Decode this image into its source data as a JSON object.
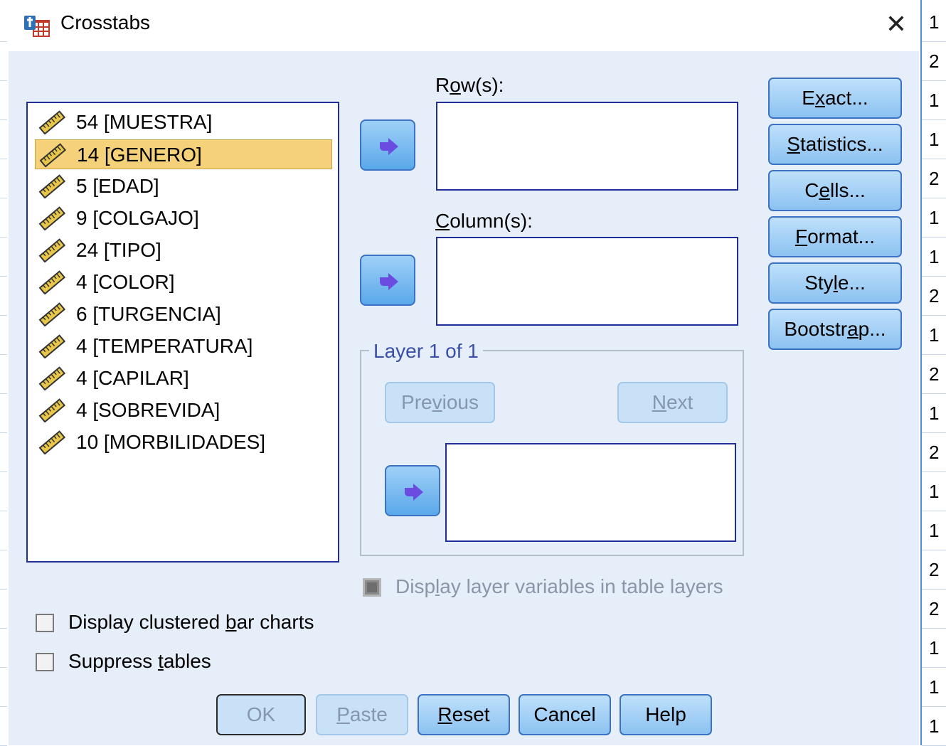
{
  "dialog": {
    "title": "Crosstabs",
    "close_glyph": "✕"
  },
  "variables": [
    {
      "label": "54 [MUESTRA]",
      "icon": "scale-ruler-icon",
      "selected": false
    },
    {
      "label": "14 [GENERO]",
      "icon": "scale-ruler-icon",
      "selected": true
    },
    {
      "label": "5 [EDAD]",
      "icon": "scale-ruler-icon",
      "selected": false
    },
    {
      "label": "9 [COLGAJO]",
      "icon": "scale-ruler-icon",
      "selected": false
    },
    {
      "label": "24 [TIPO]",
      "icon": "scale-ruler-icon",
      "selected": false
    },
    {
      "label": "4 [COLOR]",
      "icon": "scale-ruler-icon",
      "selected": false
    },
    {
      "label": "6 [TURGENCIA]",
      "icon": "scale-ruler-icon",
      "selected": false
    },
    {
      "label": "4 [TEMPERATURA]",
      "icon": "scale-ruler-icon",
      "selected": false
    },
    {
      "label": "4 [CAPILAR]",
      "icon": "scale-ruler-icon",
      "selected": false
    },
    {
      "label": "4 [SOBREVIDA]",
      "icon": "scale-ruler-icon",
      "selected": false
    },
    {
      "label": "10 [MORBILIDADES]",
      "icon": "scale-ruler-icon",
      "selected": false
    }
  ],
  "rows": {
    "label_pre": "R",
    "label_ul": "o",
    "label_post": "w(s):"
  },
  "columns": {
    "label_pre": "",
    "label_ul": "C",
    "label_post": "olumn(s):"
  },
  "layer": {
    "caption": "Layer 1 of 1",
    "previous": {
      "pre": "Pre",
      "ul": "v",
      "post": "ious"
    },
    "next": {
      "pre": "",
      "ul": "N",
      "post": "ext"
    }
  },
  "side_buttons": [
    {
      "pre": "E",
      "ul": "x",
      "post": "act..."
    },
    {
      "pre": "",
      "ul": "S",
      "post": "tatistics..."
    },
    {
      "pre": "C",
      "ul": "e",
      "post": "lls..."
    },
    {
      "pre": "",
      "ul": "F",
      "post": "ormat..."
    },
    {
      "pre": "Sty",
      "ul": "l",
      "post": "e..."
    },
    {
      "pre": "Bootstr",
      "ul": "a",
      "post": "p..."
    }
  ],
  "display_layer": {
    "pre": "Disp",
    "ul": "l",
    "post": "ay layer variables in table layers"
  },
  "checkboxes": [
    {
      "pre": "Display clustered ",
      "ul": "b",
      "post": "ar charts",
      "checked": false
    },
    {
      "pre": "Suppress ",
      "ul": "t",
      "post": "ables",
      "checked": false
    }
  ],
  "bottom_buttons": {
    "ok": {
      "pre": "OK",
      "ul": "",
      "post": ""
    },
    "paste": {
      "pre": "",
      "ul": "P",
      "post": "aste"
    },
    "reset": {
      "pre": "",
      "ul": "R",
      "post": "eset"
    },
    "cancel": {
      "pre": "Cancel",
      "ul": "",
      "post": ""
    },
    "help": {
      "pre": "Help",
      "ul": "",
      "post": ""
    }
  },
  "background_cells": [
    "1",
    "2",
    "1",
    "1",
    "2",
    "1",
    "1",
    "2",
    "1",
    "2",
    "1",
    "2",
    "1",
    "1",
    "2",
    "2",
    "1",
    "1",
    "1"
  ],
  "colors": {
    "accent": "#3b72c4",
    "selection": "#f5d27a",
    "dialog_bg": "#e6eef9",
    "list_border": "#1f2e99"
  }
}
